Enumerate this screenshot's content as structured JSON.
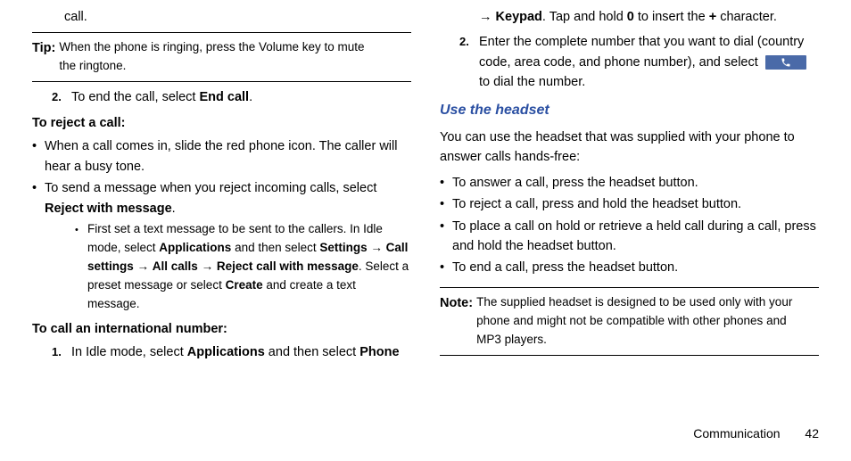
{
  "footer": {
    "section": "Communication",
    "page": "42"
  },
  "left": {
    "call_fragment": "call.",
    "tip_label": "Tip:",
    "tip_body": "When the phone is ringing, press the Volume key to mute the ringtone.",
    "endcall_num": "2.",
    "endcall_pre": "To end the call, select ",
    "endcall_bold": "End call",
    "reject_head": "To reject a call:",
    "reject_b1": "When a call comes in, slide the red phone icon. The caller will hear a busy tone.",
    "reject_b2_pre": "To send a message when you reject incoming calls, select ",
    "reject_b2_bold": "Reject with message",
    "reject_sub_pre": "First set a text message to be sent to the callers. In Idle mode, select ",
    "apps": "Applications",
    "then_sel": " and then select ",
    "settings": "Settings",
    "arrow": " → ",
    "call_settings": "Call settings",
    "all_calls": "All calls",
    "rcwm": "Reject call with message",
    "reject_sub_mid": ". Select a preset message or select ",
    "create": "Create",
    "reject_sub_end": " and create a text message.",
    "intl_head": "To call an international number:",
    "intl_num": "1.",
    "intl_pre": "In Idle mode, select ",
    "phone": "Phone"
  },
  "right": {
    "line1_arrow": "→ ",
    "keypad": "Keypad",
    "line1_mid": ". Tap and hold ",
    "zero": "0",
    "line1_mid2": " to insert the ",
    "plus": "+",
    "line1_end": " character.",
    "enter_num": "2.",
    "enter_txt": "Enter the complete number that you want to dial (country code, area code, and phone number), and select ",
    "enter_end": " to dial the number.",
    "headset_head": "Use the headset",
    "headset_intro": "You can use the headset that was supplied with your phone to answer calls hands-free:",
    "hb1": "To answer a call, press the headset button.",
    "hb2": "To reject a call, press and hold the headset button.",
    "hb3": "To place a call on hold or retrieve a held call during a call, press and hold the headset button.",
    "hb4": "To end a call, press the headset button.",
    "note_label": "Note:",
    "note_body": "The supplied headset is designed to be used only with your phone and might not be compatible with other phones and MP3 players."
  }
}
